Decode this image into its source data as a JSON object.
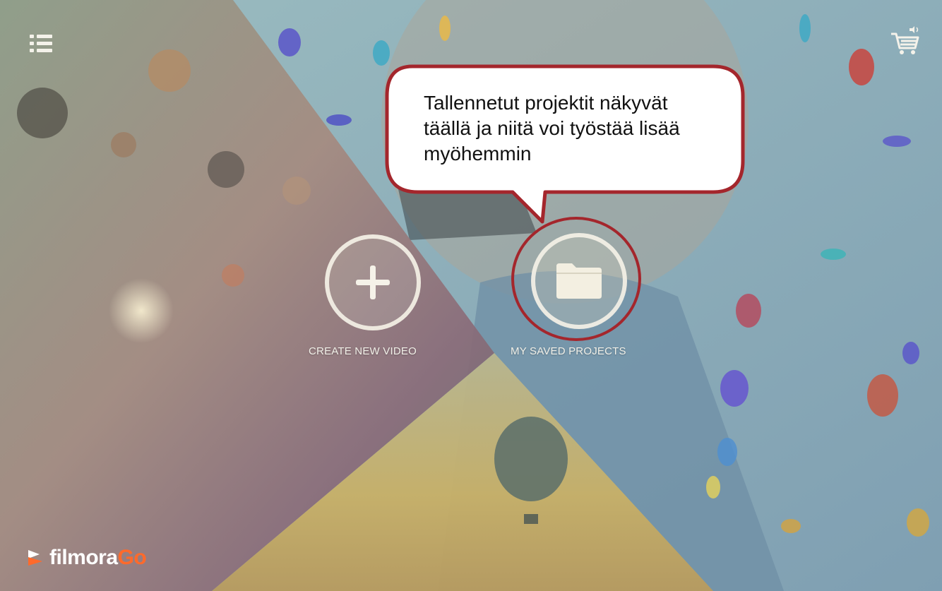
{
  "header": {
    "menu_icon": "list-icon",
    "cart_icon": "shopping-cart-icon"
  },
  "actions": {
    "create": {
      "label": "CREATE NEW VIDEO",
      "icon": "plus-icon"
    },
    "saved": {
      "label": "MY SAVED PROJECTS",
      "icon": "folder-icon"
    }
  },
  "callout": {
    "line1": "Tallennetut projektit näkyvät",
    "line2": "täällä ja niitä voi työstää lisää",
    "line3": "myöhemmin"
  },
  "brand": {
    "name_part1": "filmora",
    "name_part2": "Go"
  },
  "colors": {
    "highlight": "#a4262c",
    "brand_accent": "#ff6a2b",
    "button_ring": "#f5f2e8"
  }
}
